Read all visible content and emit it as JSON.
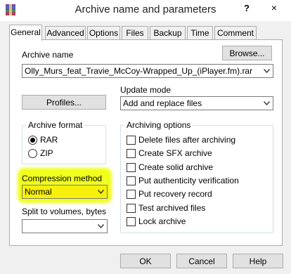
{
  "window": {
    "title": "Archive name and parameters",
    "help_label": "?",
    "close_label": "×"
  },
  "tabs": [
    {
      "label": "General",
      "active": true
    },
    {
      "label": "Advanced",
      "active": false
    },
    {
      "label": "Options",
      "active": false
    },
    {
      "label": "Files",
      "active": false
    },
    {
      "label": "Backup",
      "active": false
    },
    {
      "label": "Time",
      "active": false
    },
    {
      "label": "Comment",
      "active": false
    }
  ],
  "general": {
    "archive_name_label": "Archive name",
    "browse_label": "Browse...",
    "archive_name_value": "Olly_Murs_feat_Travie_McCoy-Wrapped_Up_(iPlayer.fm).rar",
    "profiles_label": "Profiles...",
    "update_mode_label": "Update mode",
    "update_mode_value": "Add and replace files",
    "archive_format": {
      "title": "Archive format",
      "options": [
        {
          "label": "RAR",
          "selected": true
        },
        {
          "label": "ZIP",
          "selected": false
        }
      ]
    },
    "compression_method_label": "Compression method",
    "compression_method_value": "Normal",
    "split_label": "Split to volumes, bytes",
    "split_value": "",
    "archiving_options": {
      "title": "Archiving options",
      "items": [
        {
          "label": "Delete files after archiving",
          "checked": false
        },
        {
          "label": "Create SFX archive",
          "checked": false
        },
        {
          "label": "Create solid archive",
          "checked": false
        },
        {
          "label": "Put authenticity verification",
          "checked": false
        },
        {
          "label": "Put recovery record",
          "checked": false
        },
        {
          "label": "Test archived files",
          "checked": false
        },
        {
          "label": "Lock archive",
          "checked": false
        }
      ]
    }
  },
  "footer": {
    "ok_label": "OK",
    "cancel_label": "Cancel",
    "help_label": "Help"
  },
  "colors": {
    "highlight": "#f0ff1e",
    "panel": "#ffffff",
    "window": "#f0f0f0"
  }
}
